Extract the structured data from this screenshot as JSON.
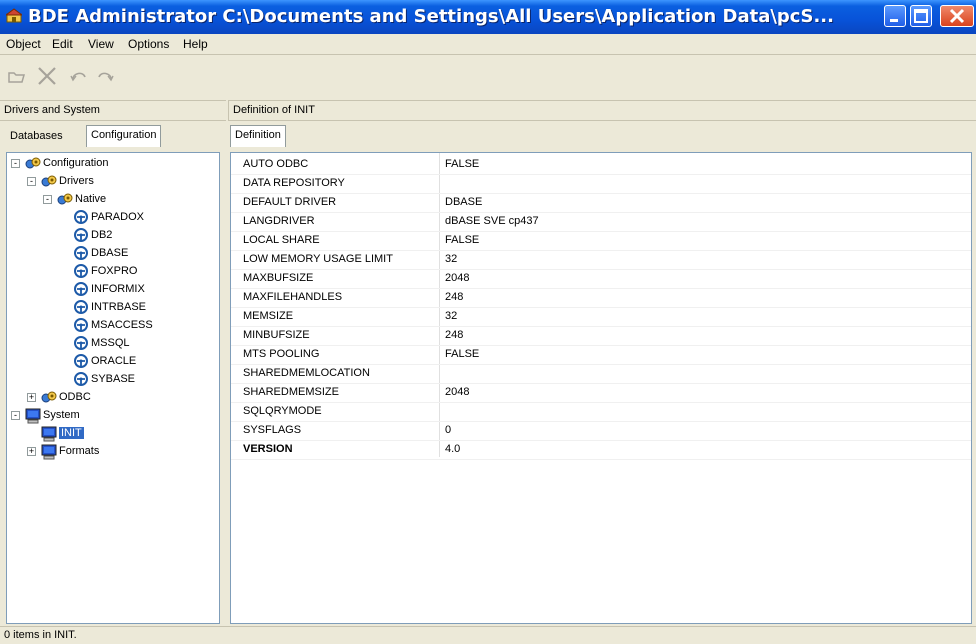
{
  "window": {
    "title": "BDE Administrator  C:\\Documents and Settings\\All Users\\Application Data\\pcS...",
    "accent": "#0852d8"
  },
  "menu": [
    "Object",
    "Edit",
    "View",
    "Options",
    "Help"
  ],
  "toolbar": {
    "icons": [
      "open-icon",
      "delete-icon",
      "undo-icon",
      "redo-icon"
    ]
  },
  "left": {
    "header": "Drivers and System",
    "tabs": [
      "Databases",
      "Configuration"
    ],
    "active_tab": "Configuration",
    "tree": [
      {
        "label": "Configuration",
        "expander": "-",
        "icon": "config-icon"
      },
      {
        "label": "Drivers",
        "expander": "-",
        "icon": "config-icon"
      },
      {
        "label": "Native",
        "expander": "-",
        "icon": "config-icon"
      },
      {
        "label": "PARADOX",
        "icon": "driver-icon"
      },
      {
        "label": "DB2",
        "icon": "driver-icon"
      },
      {
        "label": "DBASE",
        "icon": "driver-icon"
      },
      {
        "label": "FOXPRO",
        "icon": "driver-icon"
      },
      {
        "label": "INFORMIX",
        "icon": "driver-icon"
      },
      {
        "label": "INTRBASE",
        "icon": "driver-icon"
      },
      {
        "label": "MSACCESS",
        "icon": "driver-icon"
      },
      {
        "label": "MSSQL",
        "icon": "driver-icon"
      },
      {
        "label": "ORACLE",
        "icon": "driver-icon"
      },
      {
        "label": "SYBASE",
        "icon": "driver-icon"
      },
      {
        "label": "ODBC",
        "expander": "+",
        "icon": "config-icon"
      },
      {
        "label": "System",
        "expander": "-",
        "icon": "computer-icon"
      },
      {
        "label": "INIT",
        "icon": "computer-icon",
        "selected": true
      },
      {
        "label": "Formats",
        "expander": "+",
        "icon": "computer-icon"
      }
    ]
  },
  "right": {
    "header": "Definition of INIT",
    "tab": "Definition",
    "properties": [
      {
        "name": "AUTO ODBC",
        "value": "FALSE"
      },
      {
        "name": "DATA REPOSITORY",
        "value": ""
      },
      {
        "name": "DEFAULT DRIVER",
        "value": "DBASE"
      },
      {
        "name": "LANGDRIVER",
        "value": "dBASE SVE cp437"
      },
      {
        "name": "LOCAL SHARE",
        "value": "FALSE"
      },
      {
        "name": "LOW MEMORY USAGE LIMIT",
        "value": "32"
      },
      {
        "name": "MAXBUFSIZE",
        "value": "2048"
      },
      {
        "name": "MAXFILEHANDLES",
        "value": "248"
      },
      {
        "name": "MEMSIZE",
        "value": "32"
      },
      {
        "name": "MINBUFSIZE",
        "value": "248"
      },
      {
        "name": "MTS POOLING",
        "value": "FALSE"
      },
      {
        "name": "SHAREDMEMLOCATION",
        "value": ""
      },
      {
        "name": "SHAREDMEMSIZE",
        "value": "2048"
      },
      {
        "name": "SQLQRYMODE",
        "value": ""
      },
      {
        "name": "SYSFLAGS",
        "value": "0"
      },
      {
        "name": "VERSION",
        "value": "4.0",
        "bold": true
      }
    ]
  },
  "status": "0 items in INIT."
}
